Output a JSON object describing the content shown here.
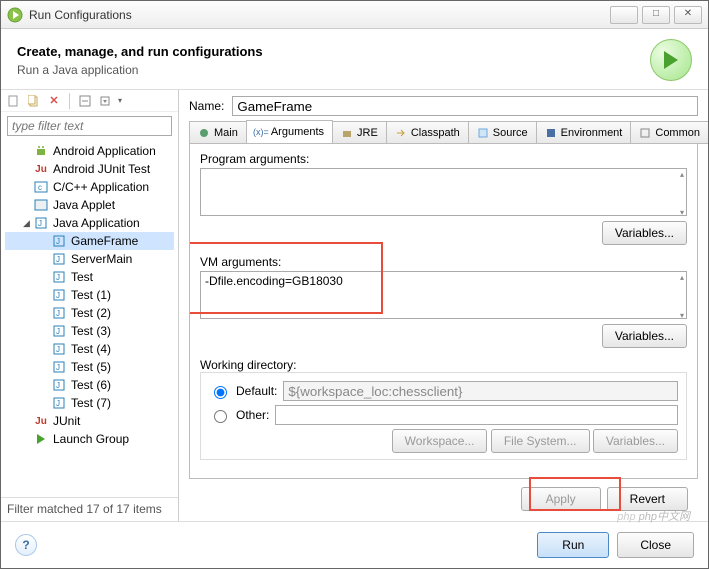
{
  "window": {
    "title": "Run Configurations"
  },
  "header": {
    "title": "Create, manage, and run configurations",
    "subtitle": "Run a Java application"
  },
  "filter": {
    "placeholder": "type filter text"
  },
  "tree": {
    "items": [
      {
        "label": "Android Application",
        "level": 1,
        "icon": "android",
        "color": "#7cb342"
      },
      {
        "label": "Android JUnit Test",
        "level": 1,
        "icon": "junit",
        "color": "#c0392b"
      },
      {
        "label": "C/C++ Application",
        "level": 1,
        "icon": "c",
        "color": "#2980b9"
      },
      {
        "label": "Java Applet",
        "level": 1,
        "icon": "applet",
        "color": "#2980b9"
      },
      {
        "label": "Java Application",
        "level": 1,
        "icon": "java",
        "color": "#2980b9",
        "expanded": true
      },
      {
        "label": "GameFrame",
        "level": 2,
        "icon": "java",
        "color": "#2980b9",
        "selected": true
      },
      {
        "label": "ServerMain",
        "level": 2,
        "icon": "java",
        "color": "#2980b9"
      },
      {
        "label": "Test",
        "level": 2,
        "icon": "java",
        "color": "#2980b9"
      },
      {
        "label": "Test (1)",
        "level": 2,
        "icon": "java",
        "color": "#2980b9"
      },
      {
        "label": "Test (2)",
        "level": 2,
        "icon": "java",
        "color": "#2980b9"
      },
      {
        "label": "Test (3)",
        "level": 2,
        "icon": "java",
        "color": "#2980b9"
      },
      {
        "label": "Test (4)",
        "level": 2,
        "icon": "java",
        "color": "#2980b9"
      },
      {
        "label": "Test (5)",
        "level": 2,
        "icon": "java",
        "color": "#2980b9"
      },
      {
        "label": "Test (6)",
        "level": 2,
        "icon": "java",
        "color": "#2980b9"
      },
      {
        "label": "Test (7)",
        "level": 2,
        "icon": "java",
        "color": "#2980b9"
      },
      {
        "label": "JUnit",
        "level": 1,
        "icon": "junit",
        "color": "#c0392b"
      },
      {
        "label": "Launch Group",
        "level": 1,
        "icon": "launch",
        "color": "#27ae60"
      }
    ]
  },
  "status_text": "Filter matched 17 of 17 items",
  "form": {
    "name_label": "Name:",
    "name_value": "GameFrame",
    "tabs": [
      "Main",
      "Arguments",
      "JRE",
      "Classpath",
      "Source",
      "Environment",
      "Common"
    ],
    "active_tab": 1,
    "program_args_label": "Program arguments:",
    "program_args_value": "",
    "vm_args_label": "VM arguments:",
    "vm_args_value": "-Dfile.encoding=GB18030",
    "variables_btn": "Variables...",
    "working_dir_label": "Working directory:",
    "default_label": "Default:",
    "default_value": "${workspace_loc:chessclient}",
    "other_label": "Other:",
    "workspace_btn": "Workspace...",
    "filesystem_btn": "File System...",
    "apply_btn": "Apply",
    "revert_btn": "Revert"
  },
  "dialog": {
    "run_btn": "Run",
    "close_btn": "Close"
  },
  "watermark": "php中文网"
}
